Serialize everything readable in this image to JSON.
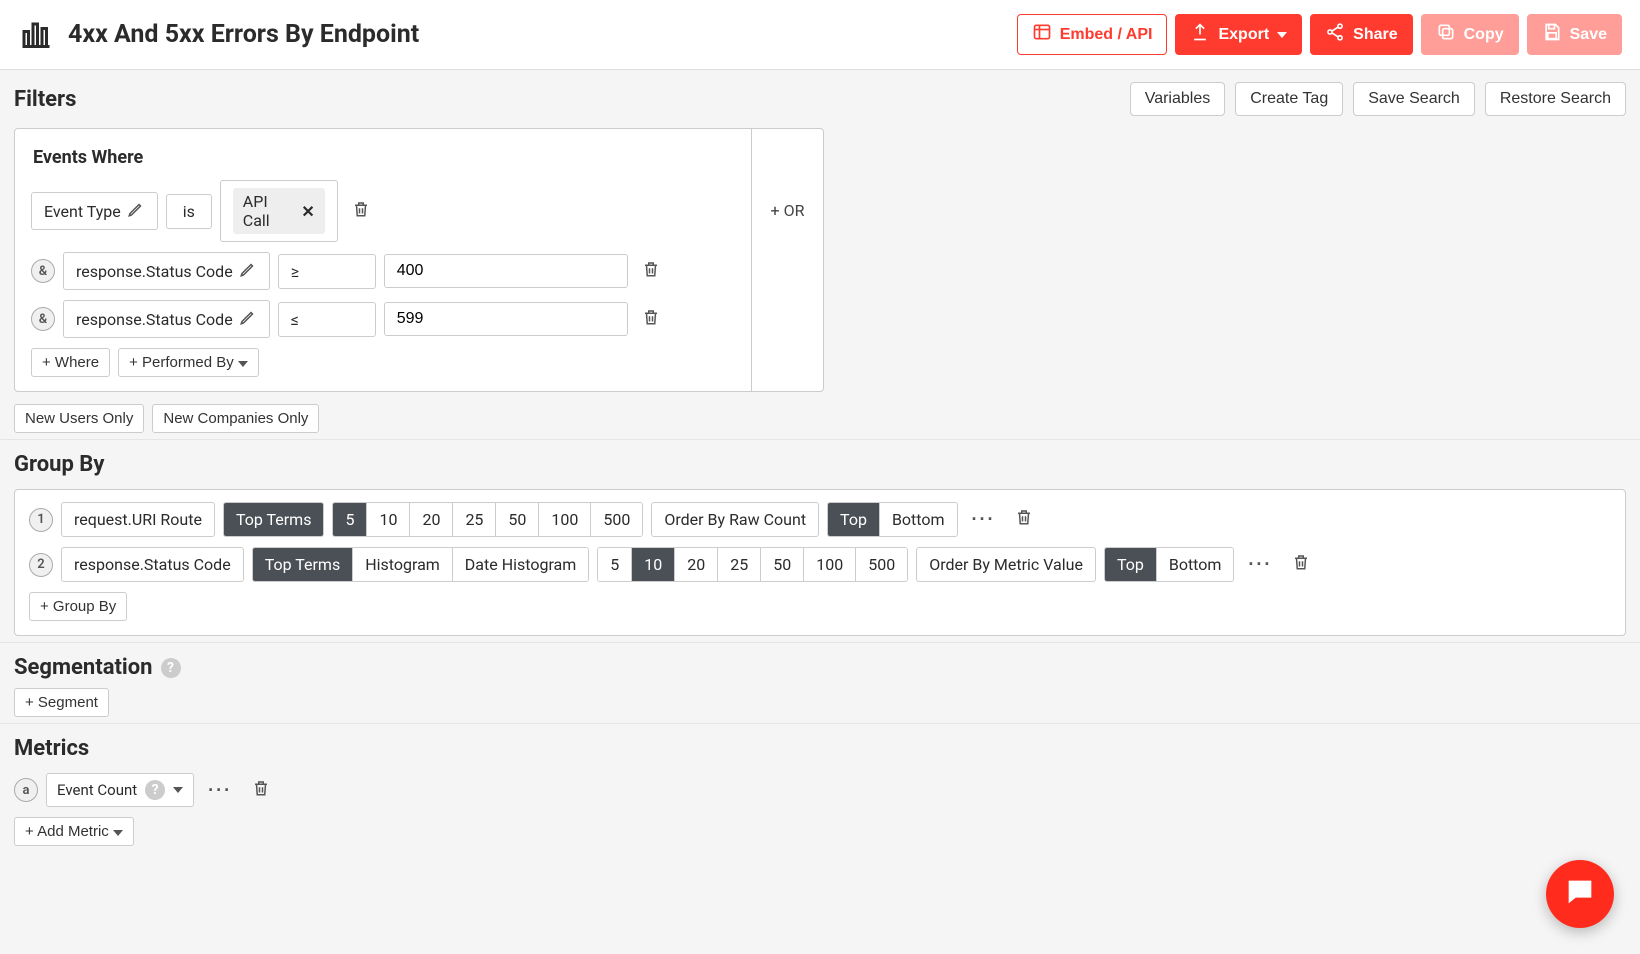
{
  "header": {
    "title": "4xx And 5xx Errors By Endpoint",
    "embed": "Embed / API",
    "export": "Export",
    "share": "Share",
    "copy": "Copy",
    "save": "Save"
  },
  "filters": {
    "title": "Filters",
    "actions": {
      "variables": "Variables",
      "create_tag": "Create Tag",
      "save_search": "Save Search",
      "restore_search": "Restore Search"
    },
    "events_where": "Events Where",
    "rows": [
      {
        "field": "Event Type",
        "op": "is",
        "chip": "API Call"
      },
      {
        "and": "&",
        "field": "response.Status Code",
        "op": "≥",
        "val": "400"
      },
      {
        "and": "&",
        "field": "response.Status Code",
        "op": "≤",
        "val": "599"
      }
    ],
    "add_where": "+ Where",
    "performed_by": "+ Performed By",
    "or": "+ OR",
    "new_users": "New Users Only",
    "new_companies": "New Companies Only"
  },
  "groupby": {
    "title": "Group By",
    "rows": [
      {
        "idx": "1",
        "field": "request.URI Route",
        "modes": [
          "Top Terms"
        ],
        "active_mode": "Top Terms",
        "sizes": [
          "5",
          "10",
          "20",
          "25",
          "50",
          "100",
          "500"
        ],
        "active_size": "5",
        "order_label": "Order By Raw Count",
        "dir": [
          "Top",
          "Bottom"
        ],
        "active_dir": "Top"
      },
      {
        "idx": "2",
        "field": "response.Status Code",
        "modes": [
          "Top Terms",
          "Histogram",
          "Date Histogram"
        ],
        "active_mode": "Top Terms",
        "sizes": [
          "5",
          "10",
          "20",
          "25",
          "50",
          "100",
          "500"
        ],
        "active_size": "10",
        "order_label": "Order By Metric Value",
        "dir": [
          "Top",
          "Bottom"
        ],
        "active_dir": "Top"
      }
    ],
    "add": "+ Group By"
  },
  "segmentation": {
    "title": "Segmentation",
    "add": "+ Segment"
  },
  "metrics": {
    "title": "Metrics",
    "rows": [
      {
        "idx": "a",
        "field": "Event Count"
      }
    ],
    "add": "+ Add Metric"
  }
}
